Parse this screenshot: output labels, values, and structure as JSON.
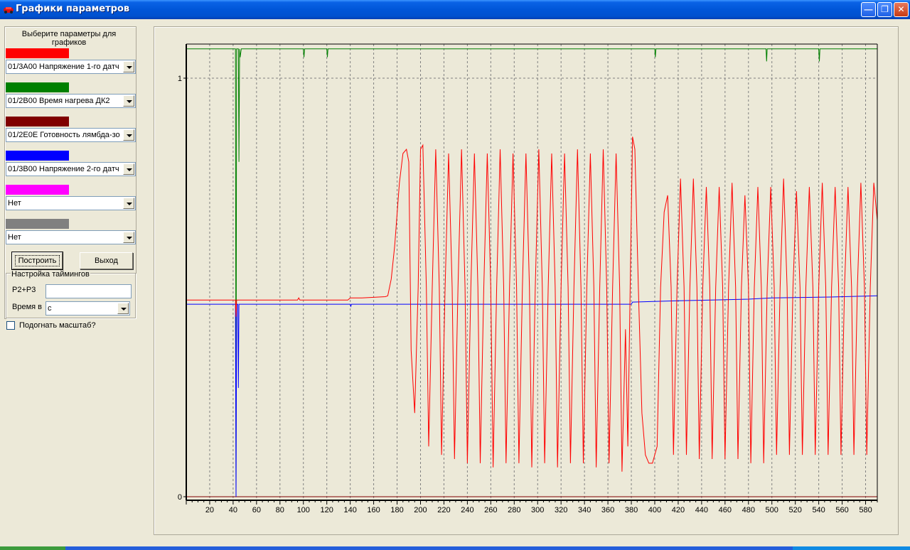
{
  "window": {
    "title": "Графики параметров",
    "buttons": [
      "minimize",
      "maximize",
      "close"
    ]
  },
  "left_panel": {
    "instruction": "Выберите параметры для графиков",
    "selectors": [
      {
        "color": "#ff0000",
        "value": "01/3A00 Напряжение 1-го датч"
      },
      {
        "color": "#008000",
        "value": "01/2B00 Время нагрева ДК2"
      },
      {
        "color": "#800000",
        "value": "01/2E0E Готовность лямбда-зо"
      },
      {
        "color": "#0000ff",
        "value": "01/3B00 Напряжение 2-го датч"
      },
      {
        "color": "#ff00ff",
        "value": "Нет"
      },
      {
        "color": "#808080",
        "value": "Нет"
      }
    ],
    "build_button": "Построить",
    "exit_button": "Выход",
    "timing": {
      "title": "Настройка таймингов",
      "p2p3_label": "P2+P3",
      "p2p3_value": "",
      "time_label": "Время в",
      "time_unit": "с"
    },
    "fit_scale": {
      "label": "Подогнать масштаб?",
      "checked": false
    }
  },
  "chart_data": {
    "type": "line",
    "xlim": [
      0,
      590
    ],
    "ylim": [
      0,
      1.1
    ],
    "x_ticks": [
      20,
      40,
      60,
      80,
      100,
      120,
      140,
      160,
      180,
      200,
      220,
      240,
      260,
      280,
      300,
      320,
      340,
      360,
      380,
      400,
      420,
      440,
      460,
      480,
      500,
      520,
      540,
      560,
      580
    ],
    "y_ticks": [
      "0",
      "1"
    ],
    "grid": "vertical dashed every 20, horizontal dashed at y=1",
    "series": [
      {
        "color": "#008000",
        "points": [
          [
            0,
            1.07
          ],
          [
            42,
            1.07
          ],
          [
            42.5,
            0
          ],
          [
            43,
            1.07
          ],
          [
            44.5,
            1.07
          ],
          [
            45,
            0.8
          ],
          [
            45.5,
            1.07
          ],
          [
            46,
            1.05
          ],
          [
            47,
            1.07
          ],
          [
            100,
            1.07
          ],
          [
            100.5,
            1.05
          ],
          [
            101,
            1.07
          ],
          [
            120,
            1.07
          ],
          [
            120.5,
            1.05
          ],
          [
            121,
            1.07
          ],
          [
            400,
            1.07
          ],
          [
            400.5,
            1.05
          ],
          [
            401,
            1.07
          ],
          [
            495,
            1.07
          ],
          [
            495.5,
            1.04
          ],
          [
            496,
            1.07
          ],
          [
            540,
            1.07
          ],
          [
            540.5,
            1.04
          ],
          [
            541,
            1.07
          ],
          [
            590,
            1.07
          ]
        ]
      },
      {
        "color": "#800000",
        "points": [
          [
            0,
            0
          ],
          [
            590,
            0
          ]
        ]
      },
      {
        "color": "#0000ff",
        "points": [
          [
            0,
            0.46
          ],
          [
            42,
            0.46
          ],
          [
            42.5,
            0
          ],
          [
            43,
            0.46
          ],
          [
            44,
            0.46
          ],
          [
            44.5,
            0.26
          ],
          [
            45,
            0.46
          ],
          [
            140,
            0.46
          ],
          [
            140.5,
            0.455
          ],
          [
            141,
            0.46
          ],
          [
            300,
            0.46
          ],
          [
            380,
            0.46
          ],
          [
            381,
            0.465
          ],
          [
            420,
            0.468
          ],
          [
            480,
            0.472
          ],
          [
            500,
            0.475
          ],
          [
            550,
            0.477
          ],
          [
            590,
            0.48
          ]
        ]
      },
      {
        "color": "#ff0000",
        "points": [
          [
            0,
            0.47
          ],
          [
            42,
            0.47
          ],
          [
            42.5,
            0.43
          ],
          [
            43,
            0.47
          ],
          [
            95,
            0.47
          ],
          [
            96,
            0.475
          ],
          [
            97,
            0.47
          ],
          [
            138,
            0.47
          ],
          [
            140,
            0.475
          ],
          [
            150,
            0.475
          ],
          [
            170,
            0.478
          ],
          [
            172,
            0.48
          ],
          [
            175,
            0.52
          ],
          [
            178,
            0.6
          ],
          [
            182,
            0.75
          ],
          [
            185,
            0.82
          ],
          [
            188,
            0.83
          ],
          [
            190,
            0.8
          ],
          [
            192,
            0.35
          ],
          [
            195,
            0.2
          ],
          [
            198,
            0.5
          ],
          [
            200,
            0.83
          ],
          [
            202,
            0.84
          ],
          [
            205,
            0.5
          ],
          [
            207,
            0.12
          ],
          [
            210,
            0.5
          ],
          [
            213,
            0.83
          ],
          [
            216,
            0.5
          ],
          [
            218,
            0.1
          ],
          [
            221,
            0.5
          ],
          [
            224,
            0.82
          ],
          [
            227,
            0.5
          ],
          [
            229,
            0.09
          ],
          [
            232,
            0.5
          ],
          [
            235,
            0.83
          ],
          [
            238,
            0.5
          ],
          [
            240,
            0.08
          ],
          [
            243,
            0.5
          ],
          [
            246,
            0.82
          ],
          [
            249,
            0.5
          ],
          [
            251,
            0.08
          ],
          [
            254,
            0.5
          ],
          [
            257,
            0.82
          ],
          [
            260,
            0.5
          ],
          [
            262,
            0.07
          ],
          [
            265,
            0.5
          ],
          [
            268,
            0.83
          ],
          [
            271,
            0.5
          ],
          [
            273,
            0.08
          ],
          [
            276,
            0.5
          ],
          [
            279,
            0.82
          ],
          [
            282,
            0.5
          ],
          [
            284,
            0.08
          ],
          [
            287,
            0.5
          ],
          [
            290,
            0.82
          ],
          [
            293,
            0.5
          ],
          [
            295,
            0.07
          ],
          [
            298,
            0.5
          ],
          [
            301,
            0.83
          ],
          [
            304,
            0.5
          ],
          [
            306,
            0.08
          ],
          [
            309,
            0.5
          ],
          [
            312,
            0.82
          ],
          [
            315,
            0.5
          ],
          [
            317,
            0.07
          ],
          [
            320,
            0.5
          ],
          [
            323,
            0.82
          ],
          [
            326,
            0.5
          ],
          [
            328,
            0.08
          ],
          [
            331,
            0.5
          ],
          [
            334,
            0.83
          ],
          [
            337,
            0.5
          ],
          [
            339,
            0.08
          ],
          [
            342,
            0.5
          ],
          [
            345,
            0.82
          ],
          [
            348,
            0.5
          ],
          [
            350,
            0.07
          ],
          [
            353,
            0.5
          ],
          [
            356,
            0.83
          ],
          [
            359,
            0.5
          ],
          [
            361,
            0.08
          ],
          [
            364,
            0.5
          ],
          [
            367,
            0.82
          ],
          [
            370,
            0.5
          ],
          [
            372,
            0.06
          ],
          [
            375,
            0.4
          ],
          [
            377,
            0.12
          ],
          [
            379,
            0.5
          ],
          [
            381,
            0.86
          ],
          [
            383,
            0.83
          ],
          [
            386,
            0.5
          ],
          [
            389,
            0.2
          ],
          [
            392,
            0.1
          ],
          [
            395,
            0.08
          ],
          [
            398,
            0.08
          ],
          [
            402,
            0.12
          ],
          [
            405,
            0.5
          ],
          [
            408,
            0.68
          ],
          [
            411,
            0.72
          ],
          [
            414,
            0.5
          ],
          [
            416,
            0.1
          ],
          [
            419,
            0.5
          ],
          [
            422,
            0.76
          ],
          [
            425,
            0.5
          ],
          [
            427,
            0.1
          ],
          [
            430,
            0.5
          ],
          [
            433,
            0.76
          ],
          [
            436,
            0.5
          ],
          [
            438,
            0.09
          ],
          [
            441,
            0.5
          ],
          [
            444,
            0.74
          ],
          [
            447,
            0.5
          ],
          [
            449,
            0.09
          ],
          [
            452,
            0.5
          ],
          [
            455,
            0.74
          ],
          [
            458,
            0.5
          ],
          [
            460,
            0.09
          ],
          [
            463,
            0.5
          ],
          [
            466,
            0.75
          ],
          [
            469,
            0.5
          ],
          [
            471,
            0.09
          ],
          [
            474,
            0.5
          ],
          [
            477,
            0.72
          ],
          [
            480,
            0.5
          ],
          [
            482,
            0.08
          ],
          [
            485,
            0.5
          ],
          [
            488,
            0.74
          ],
          [
            491,
            0.5
          ],
          [
            493,
            0.08
          ],
          [
            496,
            0.5
          ],
          [
            499,
            0.74
          ],
          [
            502,
            0.5
          ],
          [
            504,
            0.1
          ],
          [
            507,
            0.5
          ],
          [
            510,
            0.76
          ],
          [
            513,
            0.5
          ],
          [
            515,
            0.1
          ],
          [
            518,
            0.5
          ],
          [
            521,
            0.73
          ],
          [
            524,
            0.5
          ],
          [
            526,
            0.1
          ],
          [
            529,
            0.5
          ],
          [
            532,
            0.74
          ],
          [
            535,
            0.5
          ],
          [
            537,
            0.1
          ],
          [
            540,
            0.5
          ],
          [
            543,
            0.75
          ],
          [
            546,
            0.5
          ],
          [
            548,
            0.1
          ],
          [
            551,
            0.5
          ],
          [
            554,
            0.74
          ],
          [
            557,
            0.5
          ],
          [
            559,
            0.1
          ],
          [
            562,
            0.5
          ],
          [
            565,
            0.74
          ],
          [
            568,
            0.5
          ],
          [
            570,
            0.1
          ],
          [
            573,
            0.5
          ],
          [
            576,
            0.75
          ],
          [
            579,
            0.5
          ],
          [
            581,
            0.1
          ],
          [
            584,
            0.5
          ],
          [
            587,
            0.75
          ],
          [
            590,
            0.66
          ]
        ]
      }
    ]
  }
}
